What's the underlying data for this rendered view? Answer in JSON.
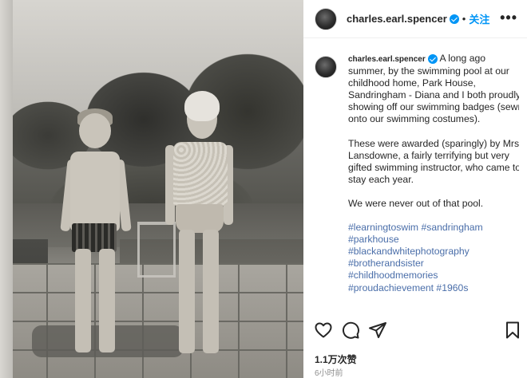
{
  "post": {
    "username": "charles.earl.spencer",
    "separator": "•",
    "follow_label": "关注",
    "more_label": "•••",
    "caption_username": "charles.earl.spencer",
    "caption_paragraphs": [
      "A long ago summer, by the swimming pool at our childhood home, Park House, Sandringham - Diana and I both proudly showing off our swimming badges (sewn onto our swimming costumes).",
      "These were awarded (sparingly) by Mrs Lansdowne, a fairly terrifying but very gifted swimming instructor, who came to stay each year.",
      "We were never out of that pool."
    ],
    "hashtags": [
      "#learningtoswim #sandringham",
      "#parkhouse",
      "#blackandwhitephotography",
      "#brotherandsister",
      "#childhoodmemories",
      "#proudachievement #1960s"
    ],
    "likes": "1.1万次赞",
    "time": "6小时前"
  },
  "icons": {
    "like": "heart-icon",
    "comment": "comment-icon",
    "share": "share-icon",
    "save": "bookmark-icon",
    "verified": "verified-badge-icon"
  },
  "colors": {
    "accent": "#0095f6",
    "hashtag": "#4a6ea9",
    "text": "#262626",
    "muted": "#8e8e8e"
  }
}
